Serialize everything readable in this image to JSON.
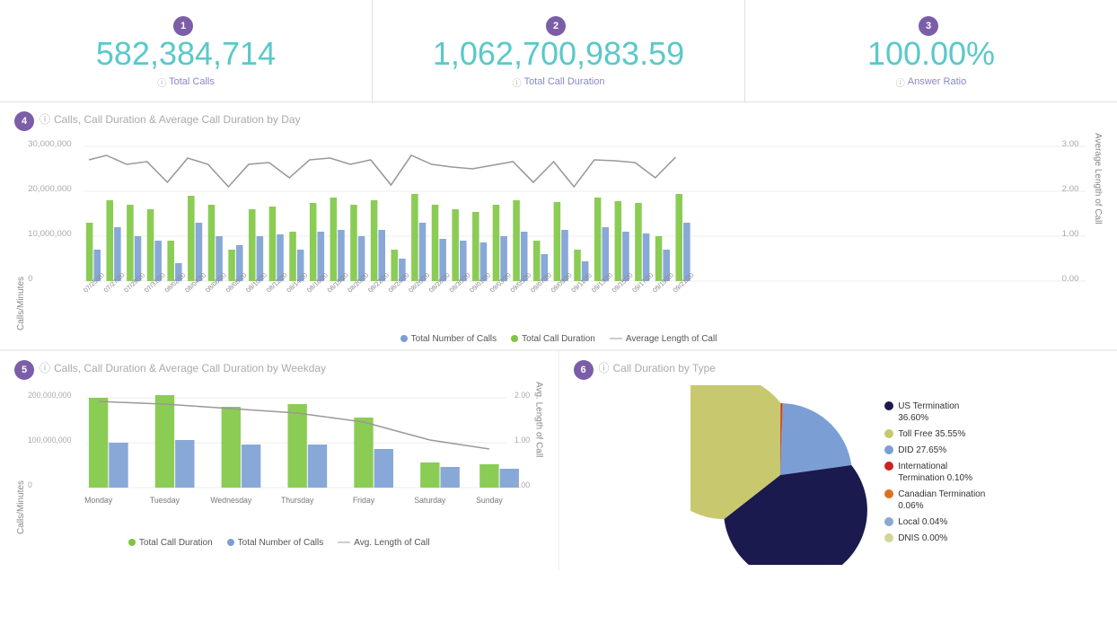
{
  "metrics": [
    {
      "id": "1",
      "value": "582,384,714",
      "label": "Total Calls"
    },
    {
      "id": "2",
      "value": "1,062,700,983.59",
      "label": "Total Call Duration"
    },
    {
      "id": "3",
      "value": "100.00%",
      "label": "Answer Ratio"
    }
  ],
  "chart1": {
    "title": "Calls, Call Duration & Average Call Duration by Day",
    "section_num": "4",
    "y_label": "Calls/Minutes",
    "y2_label": "Average Length of Call",
    "legend": [
      {
        "label": "Total Number of Calls",
        "color": "#7b9fd4",
        "type": "dot"
      },
      {
        "label": "Total Call Duration",
        "color": "#7ec642",
        "type": "dot"
      },
      {
        "label": "Average Length of Call",
        "color": "#ccc",
        "type": "line"
      }
    ]
  },
  "chart2": {
    "title": "Calls, Call Duration & Average Call Duration by Weekday",
    "section_num": "5",
    "y_label": "Calls/Minutes",
    "y2_label": "Avg. Length of Call",
    "days": [
      "Monday",
      "Tuesday",
      "Wednesday",
      "Thursday",
      "Friday",
      "Saturday",
      "Sunday"
    ],
    "legend": [
      {
        "label": "Total Call Duration",
        "color": "#7ec642",
        "type": "dot"
      },
      {
        "label": "Total Number of Calls",
        "color": "#7b9fd4",
        "type": "dot"
      },
      {
        "label": "Avg. Length of Call",
        "color": "#ccc",
        "type": "line"
      }
    ]
  },
  "chart3": {
    "title": "Call Duration by Type",
    "section_num": "6",
    "legend": [
      {
        "label": "US Termination 36.60%",
        "color": "#1a1a4e"
      },
      {
        "label": "Toll Free 35.55%",
        "color": "#c8c86e"
      },
      {
        "label": "DID 27.65%",
        "color": "#7b9fd4"
      },
      {
        "label": "International Termination 0.10%",
        "color": "#cc2222"
      },
      {
        "label": "Canadian Termination 0.06%",
        "color": "#e07020"
      },
      {
        "label": "Local 0.04%",
        "color": "#88aacc"
      },
      {
        "label": "DNIS 0.00%",
        "color": "#d4d498"
      }
    ]
  }
}
